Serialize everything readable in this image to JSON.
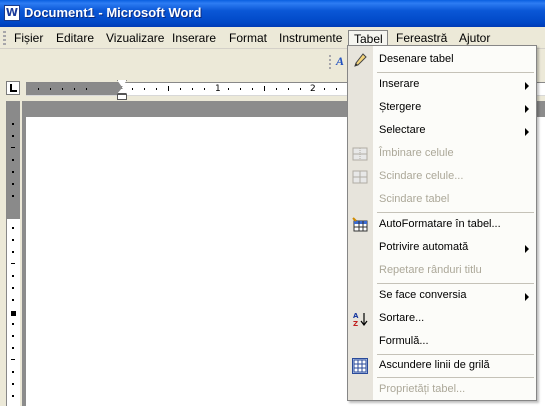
{
  "window": {
    "title": "Document1 - Microsoft Word",
    "app_icon_letter": "W"
  },
  "menubar": {
    "items": [
      {
        "label": "Fișier"
      },
      {
        "label": "Editare"
      },
      {
        "label": "Vizualizare"
      },
      {
        "label": "Inserare"
      },
      {
        "label": "Format"
      },
      {
        "label": "Instrumente"
      },
      {
        "label": "Tabel"
      },
      {
        "label": "Fereastră"
      },
      {
        "label": "Ajutor"
      }
    ]
  },
  "ruler": {
    "numbers": [
      "1",
      "2"
    ]
  },
  "table_menu": {
    "items": [
      {
        "label": "Desenare tabel",
        "icon": "pencil-icon",
        "disabled": false,
        "submenu": false
      },
      {
        "label": "Inserare",
        "icon": "",
        "disabled": false,
        "submenu": true
      },
      {
        "label": "Ștergere",
        "icon": "",
        "disabled": false,
        "submenu": true
      },
      {
        "label": "Selectare",
        "icon": "",
        "disabled": false,
        "submenu": true
      },
      {
        "label": "Îmbinare celule",
        "icon": "merge-cells-icon",
        "disabled": true,
        "submenu": false
      },
      {
        "label": "Scindare celule...",
        "icon": "split-cells-icon",
        "disabled": true,
        "submenu": false
      },
      {
        "label": "Scindare tabel",
        "icon": "",
        "disabled": true,
        "submenu": false
      },
      {
        "label": "AutoFormatare în tabel...",
        "icon": "table-autoformat-icon",
        "disabled": false,
        "submenu": false
      },
      {
        "label": "Potrivire automată",
        "icon": "",
        "disabled": false,
        "submenu": true
      },
      {
        "label": "Repetare rânduri titlu",
        "icon": "",
        "disabled": true,
        "submenu": false
      },
      {
        "label": "Se face conversia",
        "icon": "",
        "disabled": false,
        "submenu": true
      },
      {
        "label": "Sortare...",
        "icon": "sort-az-icon",
        "disabled": false,
        "submenu": false
      },
      {
        "label": "Formulă...",
        "icon": "",
        "disabled": false,
        "submenu": false
      },
      {
        "label": "Ascundere linii de grilă",
        "icon": "gridlines-icon",
        "disabled": false,
        "submenu": false
      },
      {
        "label": "Proprietăți tabel...",
        "icon": "",
        "disabled": true,
        "submenu": false
      }
    ]
  }
}
